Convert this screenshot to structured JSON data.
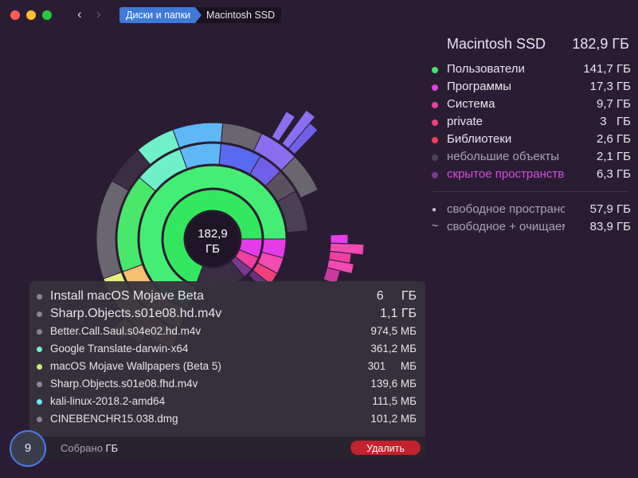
{
  "window": {
    "breadcrumbs": [
      "Диски и папки",
      "Macintosh SSD"
    ],
    "nav": {
      "back": "‹",
      "forward": "›"
    }
  },
  "sunburst": {
    "center_size": "182,9",
    "center_unit": "ГБ"
  },
  "right_panel": {
    "title": "Macintosh SSD",
    "title_size": "182,9 ГБ",
    "categories": [
      {
        "name": "Пользователи",
        "size": "141,7 ГБ",
        "color": "#3ee86a"
      },
      {
        "name": "Программы",
        "size": "17,3 ГБ",
        "color": "#e63ce8"
      },
      {
        "name": "Система",
        "size": "9,7 ГБ",
        "color": "#ef3fa0"
      },
      {
        "name": "private",
        "size": "3   ГБ",
        "color": "#ef3f7c"
      },
      {
        "name": "Библиотеки",
        "size": "2,6 ГБ",
        "color": "#ef3f5a"
      },
      {
        "name": "небольшие объекты",
        "size": "2,1 ГБ",
        "color": "#4a4152"
      },
      {
        "name": "скрытое пространство",
        "size": "6,3 ГБ",
        "color": "#7a3a90"
      }
    ],
    "free": [
      {
        "sign": "●",
        "name": "свободное пространство",
        "size": "57,9 ГБ"
      },
      {
        "sign": "~",
        "name": "свободное + очищаемое",
        "size": "83,9 ГБ"
      }
    ]
  },
  "collection": {
    "items": [
      {
        "name": "Install macOS Mojave Beta",
        "size": "6     ГБ",
        "color": "#8a8690",
        "large": true
      },
      {
        "name": "Sharp.Objects.s01e08.hd.m4v",
        "size": "1,1 ГБ",
        "color": "#8a8690",
        "large": true
      },
      {
        "name": "Better.Call.Saul.s04e02.hd.m4v",
        "size": "974,5 МБ",
        "color": "#8a8690",
        "large": false
      },
      {
        "name": "Google Translate-darwin-x64",
        "size": "361,2 МБ",
        "color": "#6ff0d0",
        "large": false
      },
      {
        "name": "macOS Mojave Wallpapers (Beta 5)",
        "size": "301     МБ",
        "color": "#c8f070",
        "large": false
      },
      {
        "name": "Sharp.Objects.s01e08.fhd.m4v",
        "size": "139,6 МБ",
        "color": "#8a8690",
        "large": false
      },
      {
        "name": "kali-linux-2018.2-amd64",
        "size": "111,5 МБ",
        "color": "#6ee6f5",
        "large": false
      },
      {
        "name": "CINEBENCHR15.038.dmg",
        "size": "101,2 МБ",
        "color": "#8a8690",
        "large": false
      }
    ],
    "footer_label": "Собрано",
    "footer_unit": "ГБ",
    "delete_label": "Удалить",
    "count": "9"
  },
  "colors": {
    "background": "#2a1d33",
    "accent": "#3e7ad8",
    "delete": "#c2212d"
  }
}
